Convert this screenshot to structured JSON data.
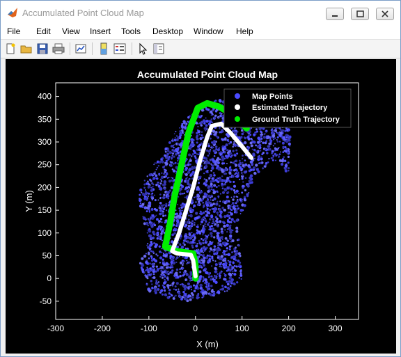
{
  "window": {
    "title": "Accumulated Point Cloud Map"
  },
  "menu": [
    "File",
    "Edit",
    "View",
    "Insert",
    "Tools",
    "Desktop",
    "Window",
    "Help"
  ],
  "toolbar": {
    "icons": [
      "new-figure-icon",
      "open-file-icon",
      "save-icon",
      "print-icon",
      "link-plot-icon",
      "colorbar-icon",
      "legend-icon",
      "pointer-icon",
      "property-inspector-icon"
    ]
  },
  "colors": {
    "figure_bg": "#000000",
    "axis": "#ffffff",
    "map_points": "#4b4bff",
    "estimated": "#ffffff",
    "ground_truth": "#00ee00"
  },
  "chart_data": {
    "type": "scatter",
    "title": "Accumulated Point Cloud Map",
    "xlabel": "X (m)",
    "ylabel": "Y (m)",
    "xlim": [
      -300,
      350
    ],
    "ylim": [
      -90,
      430
    ],
    "xticks": [
      -300,
      -200,
      -100,
      0,
      100,
      200,
      300
    ],
    "yticks": [
      -50,
      0,
      50,
      100,
      150,
      200,
      250,
      300,
      350,
      400
    ],
    "legend_position": "top-right",
    "series": [
      {
        "name": "Map Points",
        "region_polygon": [
          [
            -110,
            -20
          ],
          [
            -80,
            -40
          ],
          [
            -20,
            -50
          ],
          [
            30,
            -40
          ],
          [
            80,
            -25
          ],
          [
            100,
            0
          ],
          [
            95,
            60
          ],
          [
            90,
            120
          ],
          [
            110,
            170
          ],
          [
            130,
            230
          ],
          [
            170,
            260
          ],
          [
            200,
            230
          ],
          [
            205,
            330
          ],
          [
            140,
            345
          ],
          [
            90,
            370
          ],
          [
            50,
            395
          ],
          [
            20,
            380
          ],
          [
            -10,
            360
          ],
          [
            -40,
            330
          ],
          [
            -60,
            290
          ],
          [
            -90,
            250
          ],
          [
            -120,
            200
          ],
          [
            -120,
            150
          ],
          [
            -100,
            90
          ],
          [
            -120,
            40
          ]
        ]
      },
      {
        "name": "Estimated Trajectory",
        "points": [
          [
            0,
            5
          ],
          [
            -5,
            40
          ],
          [
            -10,
            52
          ],
          [
            -40,
            55
          ],
          [
            -50,
            60
          ],
          [
            -35,
            100
          ],
          [
            -20,
            150
          ],
          [
            -5,
            200
          ],
          [
            10,
            260
          ],
          [
            25,
            310
          ],
          [
            35,
            335
          ],
          [
            55,
            340
          ],
          [
            75,
            320
          ],
          [
            100,
            290
          ],
          [
            120,
            265
          ]
        ]
      },
      {
        "name": "Ground Truth Trajectory",
        "points": [
          [
            0,
            0
          ],
          [
            0,
            30
          ],
          [
            -5,
            55
          ],
          [
            -40,
            60
          ],
          [
            -65,
            70
          ],
          [
            -55,
            120
          ],
          [
            -45,
            180
          ],
          [
            -30,
            250
          ],
          [
            -15,
            320
          ],
          [
            5,
            375
          ],
          [
            25,
            385
          ],
          [
            50,
            378
          ],
          [
            80,
            360
          ],
          [
            110,
            330
          ]
        ]
      }
    ]
  }
}
